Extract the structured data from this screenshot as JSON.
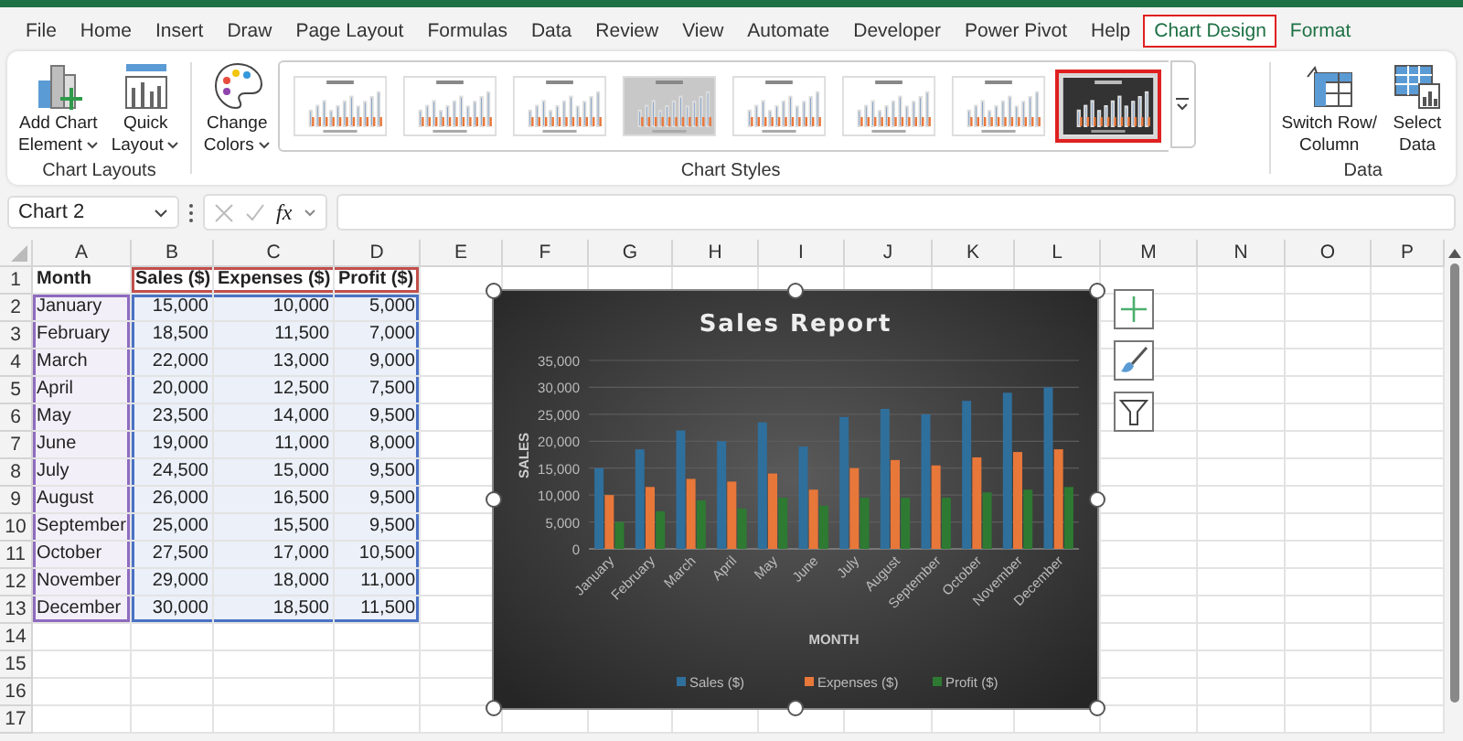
{
  "menu_tabs": [
    {
      "label": "File",
      "selected": false,
      "contextual": false,
      "annotated": false
    },
    {
      "label": "Home",
      "selected": false,
      "contextual": false,
      "annotated": false
    },
    {
      "label": "Insert",
      "selected": false,
      "contextual": false,
      "annotated": false
    },
    {
      "label": "Draw",
      "selected": false,
      "contextual": false,
      "annotated": false
    },
    {
      "label": "Page Layout",
      "selected": false,
      "contextual": false,
      "annotated": false
    },
    {
      "label": "Formulas",
      "selected": false,
      "contextual": false,
      "annotated": false
    },
    {
      "label": "Data",
      "selected": false,
      "contextual": false,
      "annotated": false
    },
    {
      "label": "Review",
      "selected": false,
      "contextual": false,
      "annotated": false
    },
    {
      "label": "View",
      "selected": false,
      "contextual": false,
      "annotated": false
    },
    {
      "label": "Automate",
      "selected": false,
      "contextual": false,
      "annotated": false
    },
    {
      "label": "Developer",
      "selected": false,
      "contextual": false,
      "annotated": false
    },
    {
      "label": "Power Pivot",
      "selected": false,
      "contextual": false,
      "annotated": false
    },
    {
      "label": "Help",
      "selected": false,
      "contextual": false,
      "annotated": false
    },
    {
      "label": "Chart Design",
      "selected": true,
      "contextual": true,
      "annotated": true
    },
    {
      "label": "Format",
      "selected": false,
      "contextual": true,
      "annotated": false
    }
  ],
  "ribbon": {
    "layouts_group": {
      "label": "Chart Layouts",
      "buttons": [
        {
          "kind": "add-element",
          "lines": [
            "Add Chart",
            "Element"
          ],
          "dropdown": true
        },
        {
          "kind": "quick-layout",
          "lines": [
            "Quick",
            "Layout"
          ],
          "dropdown": true
        }
      ]
    },
    "styles_group": {
      "label": "Chart Styles",
      "change_colors": {
        "kind": "change-colors",
        "lines": [
          "Change",
          "Colors"
        ],
        "dropdown": true
      },
      "styles": [
        {
          "kind": "light",
          "selected": false,
          "annotated": false
        },
        {
          "kind": "light",
          "selected": false,
          "annotated": false
        },
        {
          "kind": "light",
          "selected": false,
          "annotated": false
        },
        {
          "kind": "gray",
          "selected": false,
          "annotated": false
        },
        {
          "kind": "light",
          "selected": false,
          "annotated": false
        },
        {
          "kind": "light",
          "selected": false,
          "annotated": false
        },
        {
          "kind": "light",
          "selected": false,
          "annotated": false
        },
        {
          "kind": "dark",
          "selected": true,
          "annotated": true
        }
      ]
    },
    "data_group": {
      "label": "Data",
      "buttons": [
        {
          "kind": "switch-row-column",
          "lines": [
            "Switch Row/",
            "Column"
          ],
          "dropdown": false
        },
        {
          "kind": "select-data",
          "lines": [
            "Select",
            "Data"
          ],
          "dropdown": false
        }
      ]
    }
  },
  "formula_bar": {
    "name_box": "Chart 2",
    "fx": "fx"
  },
  "sheet": {
    "columns": [
      {
        "label": "A",
        "color": "#8e6bbf"
      },
      {
        "label": "B",
        "color": "#4a72c4"
      },
      {
        "label": "C",
        "color": "#4a72c4"
      },
      {
        "label": "D",
        "color": "#4a72c4"
      },
      {
        "label": "E"
      },
      {
        "label": "F"
      },
      {
        "label": "G"
      },
      {
        "label": "H"
      },
      {
        "label": "I"
      },
      {
        "label": "J"
      },
      {
        "label": "K"
      },
      {
        "label": "L"
      },
      {
        "label": "M"
      },
      {
        "label": "N"
      },
      {
        "label": "O"
      },
      {
        "label": "P"
      }
    ],
    "rows": [
      {
        "number": "1",
        "kind": "header",
        "color": "#c0504d",
        "cells": [
          "Month",
          "Sales ($)",
          "Expenses ($)",
          "Profit ($)"
        ]
      },
      {
        "number": "2",
        "kind": "data",
        "cells": [
          "January",
          "15,000",
          "10,000",
          "5,000"
        ]
      },
      {
        "number": "3",
        "kind": "data",
        "cells": [
          "February",
          "18,500",
          "11,500",
          "7,000"
        ]
      },
      {
        "number": "4",
        "kind": "data",
        "cells": [
          "March",
          "22,000",
          "13,000",
          "9,000"
        ]
      },
      {
        "number": "5",
        "kind": "data",
        "cells": [
          "April",
          "20,000",
          "12,500",
          "7,500"
        ]
      },
      {
        "number": "6",
        "kind": "data",
        "cells": [
          "May",
          "23,500",
          "14,000",
          "9,500"
        ]
      },
      {
        "number": "7",
        "kind": "data",
        "cells": [
          "June",
          "19,000",
          "11,000",
          "8,000"
        ]
      },
      {
        "number": "8",
        "kind": "data",
        "cells": [
          "July",
          "24,500",
          "15,000",
          "9,500"
        ]
      },
      {
        "number": "9",
        "kind": "data",
        "cells": [
          "August",
          "26,000",
          "16,500",
          "9,500"
        ]
      },
      {
        "number": "10",
        "kind": "data",
        "cells": [
          "September",
          "25,000",
          "15,500",
          "9,500"
        ]
      },
      {
        "number": "11",
        "kind": "data",
        "cells": [
          "October",
          "27,500",
          "17,000",
          "10,500"
        ]
      },
      {
        "number": "12",
        "kind": "data",
        "cells": [
          "November",
          "29,000",
          "18,000",
          "11,000"
        ]
      },
      {
        "number": "13",
        "kind": "data",
        "cells": [
          "December",
          "30,000",
          "18,500",
          "11,500"
        ]
      },
      {
        "number": "14",
        "kind": "empty"
      },
      {
        "number": "15",
        "kind": "empty"
      },
      {
        "number": "16",
        "kind": "empty"
      },
      {
        "number": "17",
        "kind": "empty"
      }
    ]
  },
  "chart": {
    "selected": true,
    "side_buttons": [
      {
        "kind": "add"
      },
      {
        "kind": "style"
      },
      {
        "kind": "filter"
      }
    ],
    "chart_data": {
      "type": "bar",
      "title": "Sales Report",
      "grid": true,
      "legend": "bottom",
      "xlabel": "MONTH",
      "ylabel": "SALES",
      "categories": [
        "January",
        "February",
        "March",
        "April",
        "May",
        "June",
        "July",
        "August",
        "September",
        "October",
        "November",
        "December"
      ],
      "series": [
        {
          "name": "Sales ($)",
          "color": "#2f6f9c",
          "values": [
            15000,
            18500,
            22000,
            20000,
            23500,
            19000,
            24500,
            26000,
            25000,
            27500,
            29000,
            30000
          ]
        },
        {
          "name": "Expenses ($)",
          "color": "#e8773a",
          "values": [
            10000,
            11500,
            13000,
            12500,
            14000,
            11000,
            15000,
            16500,
            15500,
            17000,
            18000,
            18500
          ]
        },
        {
          "name": "Profit ($)",
          "color": "#2e7a32",
          "values": [
            5000,
            7000,
            9000,
            7500,
            9500,
            8000,
            9500,
            9500,
            9500,
            10500,
            11000,
            11500
          ]
        }
      ],
      "ylim": [
        0,
        35000
      ],
      "yticks": [
        {
          "value": 0,
          "label": "0"
        },
        {
          "value": 5000,
          "label": "5,000"
        },
        {
          "value": 10000,
          "label": "10,000"
        },
        {
          "value": 15000,
          "label": "15,000"
        },
        {
          "value": 20000,
          "label": "20,000"
        },
        {
          "value": 25000,
          "label": "25,000"
        },
        {
          "value": 30000,
          "label": "30,000"
        },
        {
          "value": 35000,
          "label": "35,000"
        }
      ]
    }
  }
}
